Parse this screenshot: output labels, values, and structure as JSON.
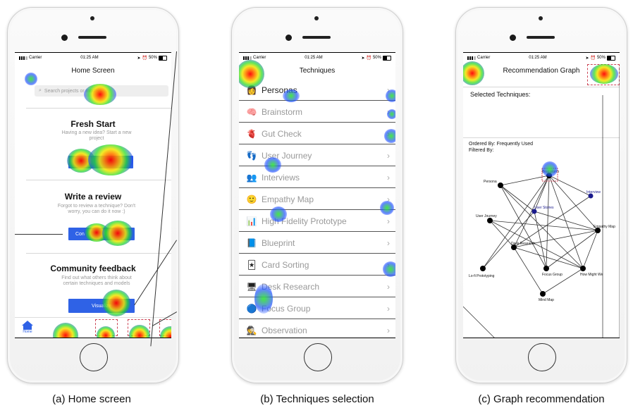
{
  "status": {
    "carrier": "Carrier",
    "time": "01:25 AM",
    "battery": "50%"
  },
  "home": {
    "title": "Home Screen",
    "search_placeholder": "Search projects or models ...",
    "sections": [
      {
        "title": "Fresh Start",
        "subtitle": "Having a new idea? Start a new project",
        "button": ""
      },
      {
        "title": "Write a review",
        "subtitle": "Forgot to review a technique? Don't worry, you can do it now :)",
        "button": "Con"
      },
      {
        "title": "Community feedback",
        "subtitle": "Find out what others think about certain techniques and models",
        "button": "Visualize"
      }
    ],
    "tab_home": "Home"
  },
  "techniques": {
    "title": "Techniques",
    "items": [
      {
        "label": "Personas",
        "icon": "persona-icon",
        "emoji": "👩",
        "selected": true
      },
      {
        "label": "Brainstorm",
        "icon": "brain-icon",
        "emoji": "🧠",
        "selected": false
      },
      {
        "label": "Gut Check",
        "icon": "gut-icon",
        "emoji": "🫀",
        "selected": false
      },
      {
        "label": "User Journey",
        "icon": "journey-icon",
        "emoji": "👣",
        "selected": false
      },
      {
        "label": "Interviews",
        "icon": "interview-icon",
        "emoji": "👥",
        "selected": false
      },
      {
        "label": "Empathy Map",
        "icon": "empathy-icon",
        "emoji": "🙂",
        "selected": false
      },
      {
        "label": "High Fidelity Prototype",
        "icon": "prototype-icon",
        "emoji": "📊",
        "selected": false
      },
      {
        "label": "Blueprint",
        "icon": "blueprint-icon",
        "emoji": "📘",
        "selected": false
      },
      {
        "label": "Card Sorting",
        "icon": "cards-icon",
        "emoji": "🃏",
        "selected": false
      },
      {
        "label": "Desk Research",
        "icon": "desk-icon",
        "emoji": "🖥",
        "selected": false
      },
      {
        "label": "Focus Group",
        "icon": "focus-icon",
        "emoji": "🔵",
        "selected": false
      },
      {
        "label": "Observation",
        "icon": "observation-icon",
        "emoji": "🕵",
        "selected": false
      }
    ]
  },
  "graph": {
    "title": "Recommendation Graph",
    "selected_label": "Selected Techniques:",
    "ordered_by": "Ordered By: Frequently Used",
    "filtered_by": "Filtered  By:",
    "nodes": [
      {
        "label": "Brainstorm"
      },
      {
        "label": "Persona"
      },
      {
        "label": "Interview"
      },
      {
        "label": "User Stories"
      },
      {
        "label": "User Journey"
      },
      {
        "label": "Empathy Map"
      },
      {
        "label": "Desk Research"
      },
      {
        "label": "Lo-fi Prototyping"
      },
      {
        "label": "Focus Group"
      },
      {
        "label": "How Might We"
      },
      {
        "label": "Mind Map"
      }
    ]
  },
  "captions": [
    "(a) Home screen",
    "(b) Techniques selection",
    "(c) Graph recommendation"
  ]
}
